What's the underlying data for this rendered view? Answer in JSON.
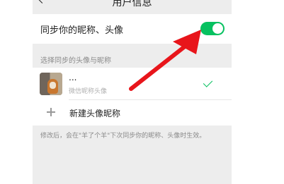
{
  "header": {
    "title": "用户信息"
  },
  "sync": {
    "label": "同步你的昵称、头像",
    "enabled": true
  },
  "section": {
    "title": "选择同步的头像与昵称"
  },
  "profiles": [
    {
      "name": "...",
      "source": "微信昵称头像",
      "selected": true
    }
  ],
  "new_profile": {
    "label": "新建头像昵称"
  },
  "footer": {
    "note": "修改后，会在\"羊了个羊\"下次同步你的昵称、头像时生效。"
  },
  "colors": {
    "toggle_on": "#07c160",
    "annotation_arrow": "#e8151b",
    "page_background": "#ededed"
  }
}
